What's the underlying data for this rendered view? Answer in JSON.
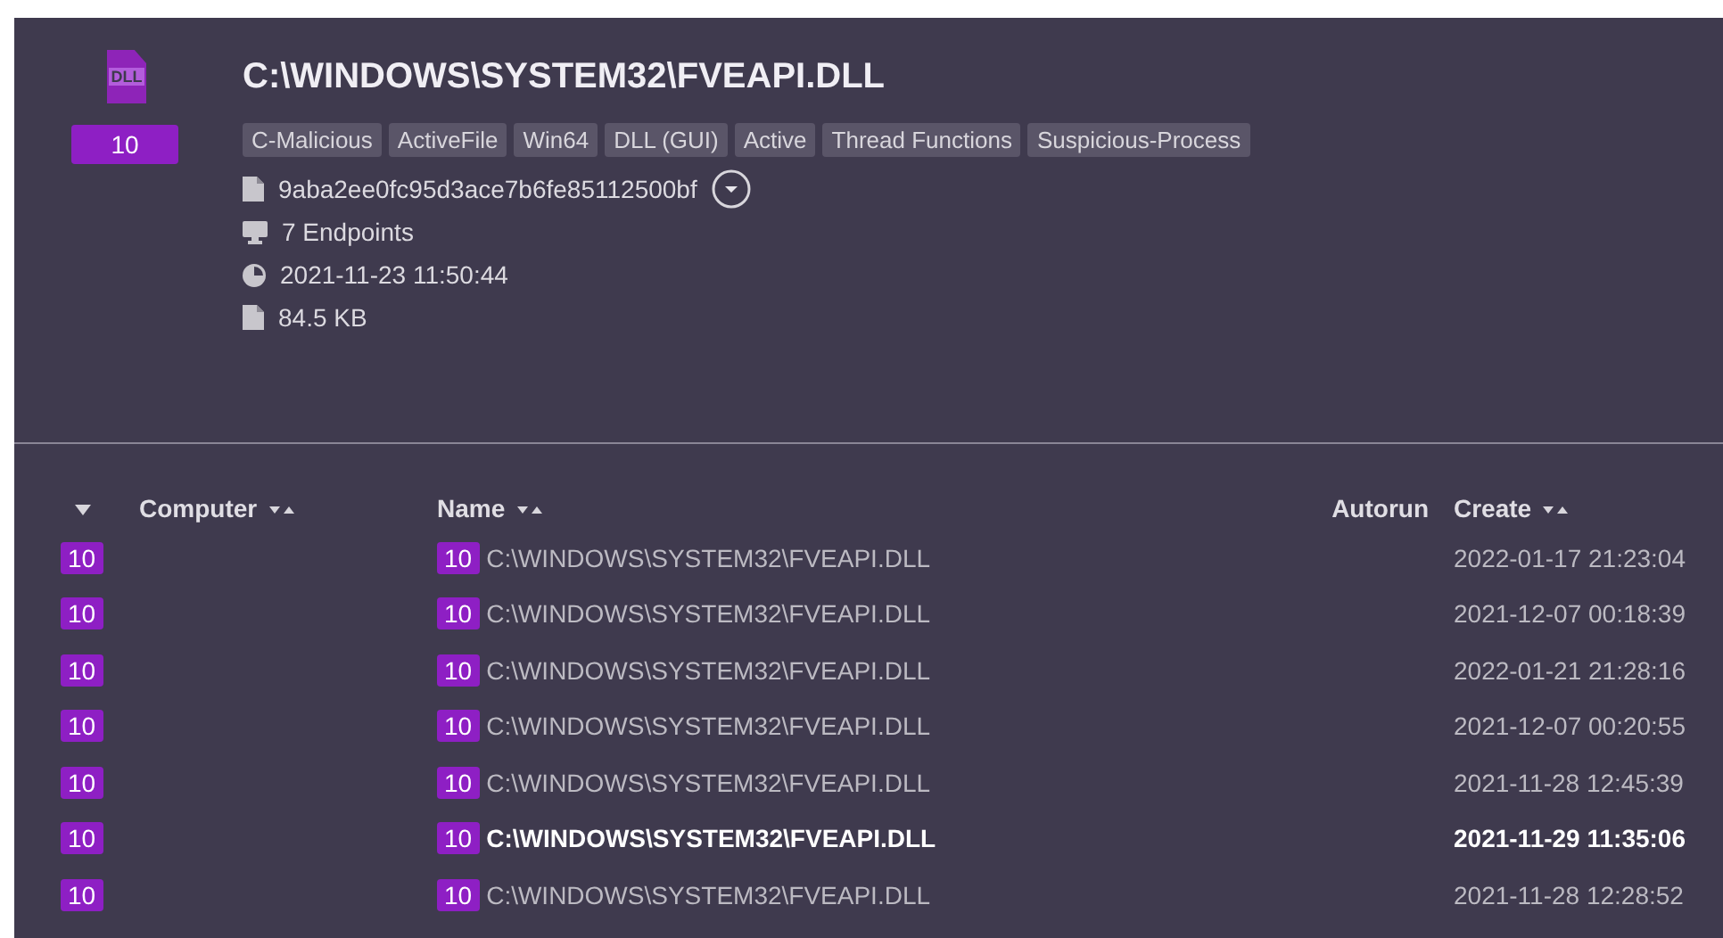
{
  "file": {
    "icon_label": "DLL",
    "score": "10",
    "title": "C:\\WINDOWS\\SYSTEM32\\FVEAPI.DLL",
    "tags": [
      "C-Malicious",
      "ActiveFile",
      "Win64",
      "DLL (GUI)",
      "Active",
      "Thread Functions",
      "Suspicious-Process"
    ],
    "details": [
      {
        "kind": "hash",
        "text": "9aba2ee0fc95d3ace7b6fe85112500bf"
      },
      {
        "kind": "endpoints",
        "text": "7 Endpoints"
      },
      {
        "kind": "time",
        "text": "2021-11-23 11:50:44"
      },
      {
        "kind": "size",
        "text": "84.5 KB"
      }
    ]
  },
  "table": {
    "columns": [
      {
        "kind": "expand"
      },
      {
        "kind": "sort",
        "label": "Computer"
      },
      {
        "kind": "sort",
        "label": "Name"
      },
      {
        "kind": "plain",
        "label": "Autorun"
      },
      {
        "kind": "sort",
        "label": "Create"
      }
    ],
    "rows": [
      {
        "score": "10",
        "name_score": "10",
        "name": "C:\\WINDOWS\\SYSTEM32\\FVEAPI.DLL",
        "create": "2022-01-17 21:23:04",
        "highlighted": false
      },
      {
        "score": "10",
        "name_score": "10",
        "name": "C:\\WINDOWS\\SYSTEM32\\FVEAPI.DLL",
        "create": "2021-12-07 00:18:39",
        "highlighted": false
      },
      {
        "score": "10",
        "name_score": "10",
        "name": "C:\\WINDOWS\\SYSTEM32\\FVEAPI.DLL",
        "create": "2022-01-21 21:28:16",
        "highlighted": false
      },
      {
        "score": "10",
        "name_score": "10",
        "name": "C:\\WINDOWS\\SYSTEM32\\FVEAPI.DLL",
        "create": "2021-12-07 00:20:55",
        "highlighted": false
      },
      {
        "score": "10",
        "name_score": "10",
        "name": "C:\\WINDOWS\\SYSTEM32\\FVEAPI.DLL",
        "create": "2021-11-28 12:45:39",
        "highlighted": false
      },
      {
        "score": "10",
        "name_score": "10",
        "name": "C:\\WINDOWS\\SYSTEM32\\FVEAPI.DLL",
        "create": "2021-11-29 11:35:06",
        "highlighted": true
      },
      {
        "score": "10",
        "name_score": "10",
        "name": "C:\\WINDOWS\\SYSTEM32\\FVEAPI.DLL",
        "create": "2021-11-28 12:28:52",
        "highlighted": false
      }
    ]
  }
}
